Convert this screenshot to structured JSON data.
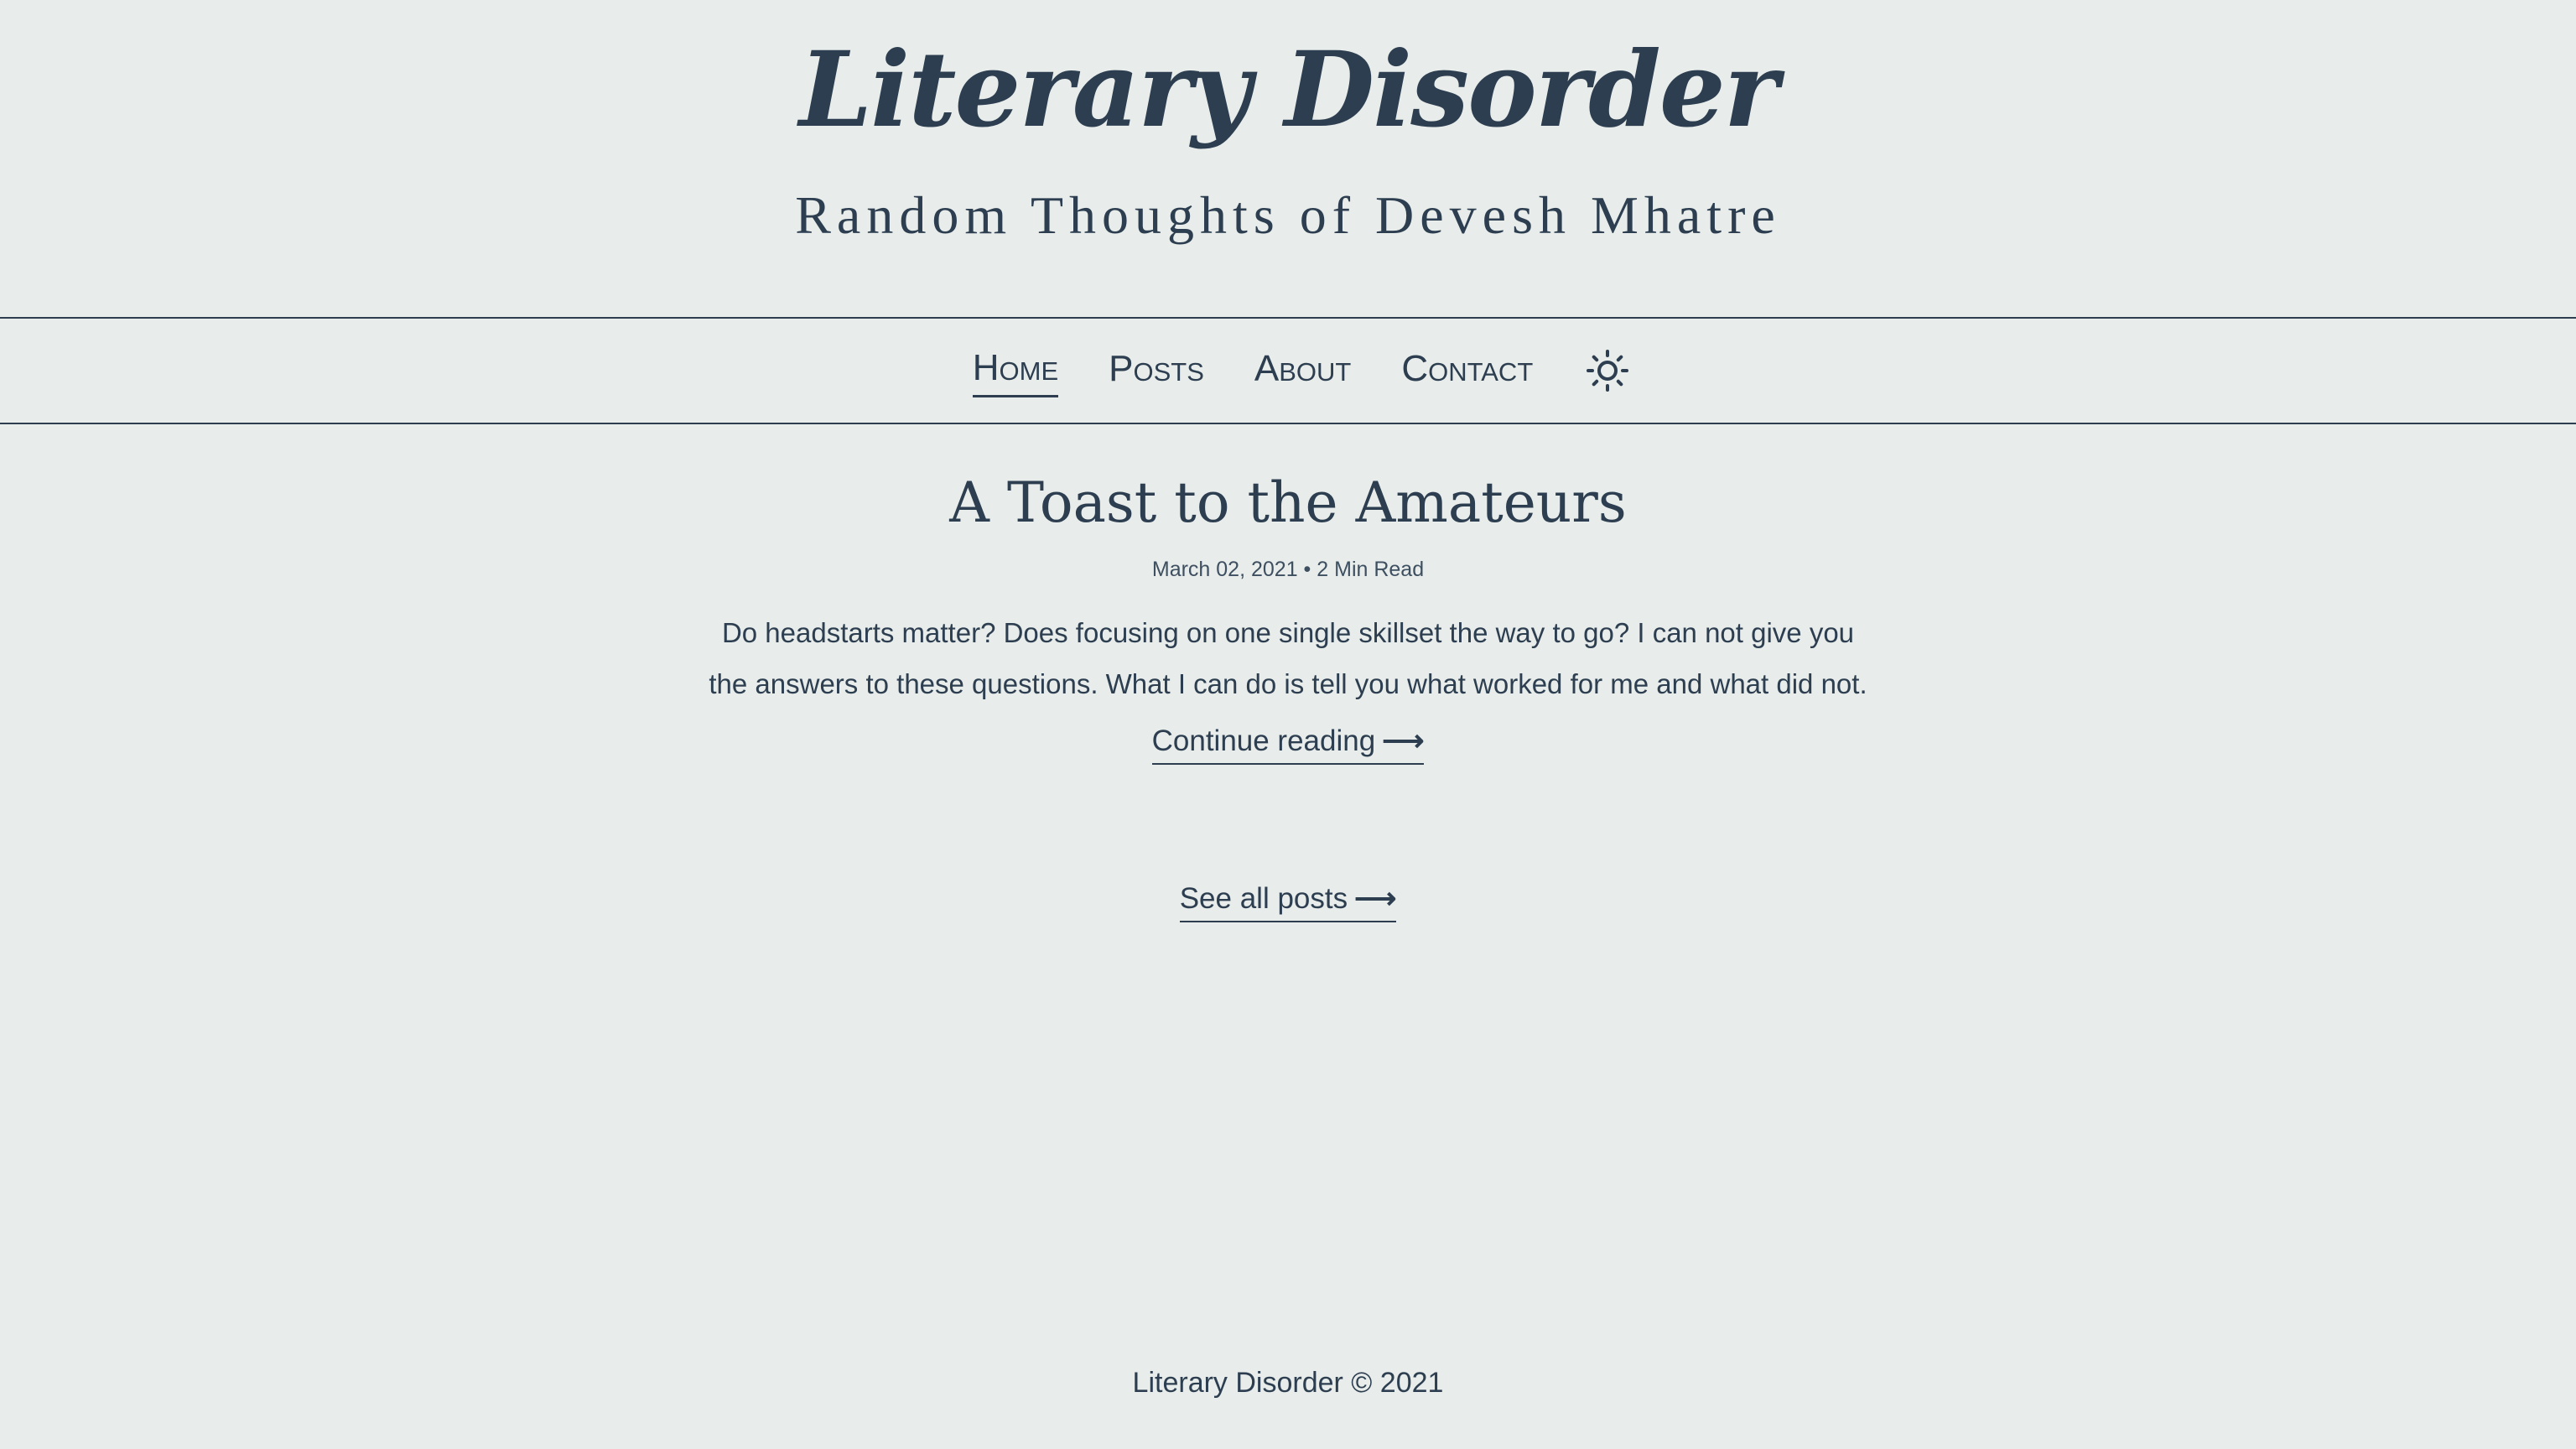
{
  "header": {
    "title": "Literary Disorder",
    "tagline": "Random Thoughts of Devesh Mhatre"
  },
  "nav": {
    "items": [
      {
        "label": "Home",
        "active": true
      },
      {
        "label": "Posts",
        "active": false
      },
      {
        "label": "About",
        "active": false
      },
      {
        "label": "Contact",
        "active": false
      }
    ],
    "theme_toggle_icon": "sun-icon"
  },
  "post": {
    "title": "A Toast to the Amateurs",
    "date": "March 02, 2021",
    "separator": "•",
    "read_time": "2 Min Read",
    "excerpt": "Do headstarts matter? Does focusing on one single skillset the way to go? I can not give you the answers to these questions. What I can do is tell you what worked for me and what did not.",
    "continue_label": "Continue reading",
    "arrow": "⟶"
  },
  "see_all": {
    "label": "See all posts",
    "arrow": "⟶"
  },
  "footer": {
    "text": "Literary Disorder © 2021"
  },
  "colors": {
    "background": "#e8ecea",
    "text": "#2c3e50"
  }
}
